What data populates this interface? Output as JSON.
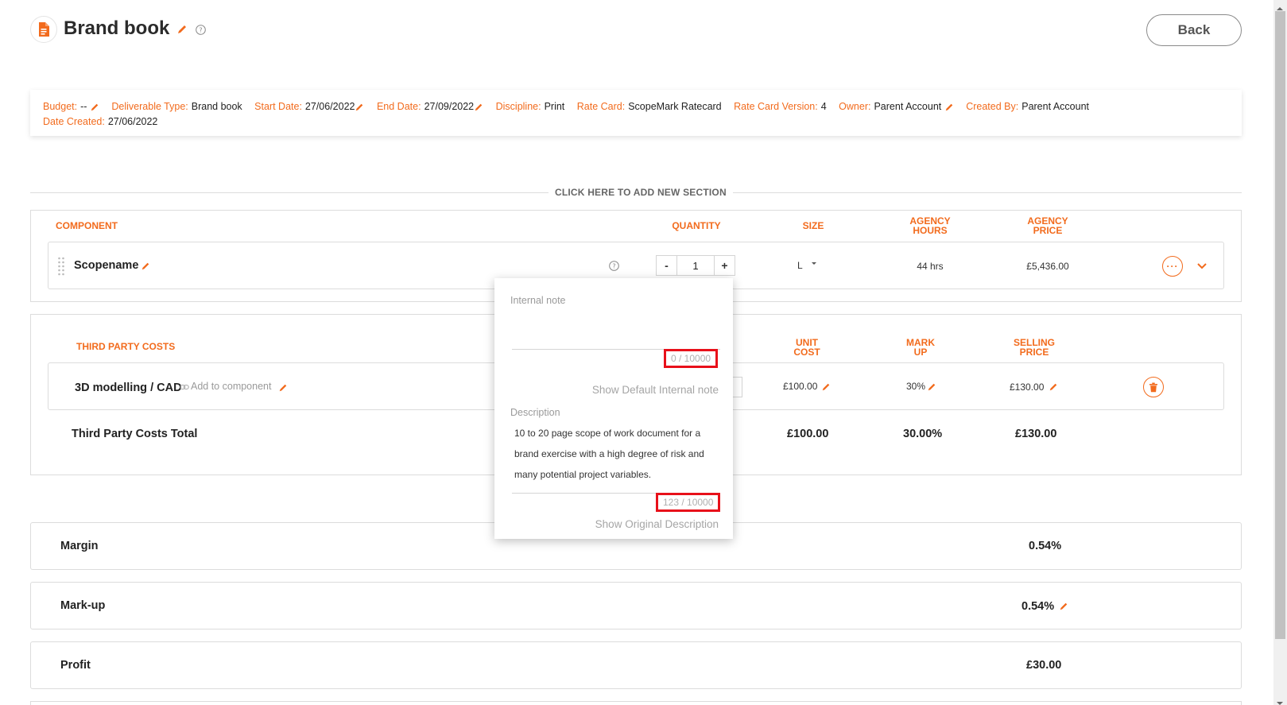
{
  "header": {
    "title": "Brand book",
    "back_label": "Back"
  },
  "info_bar": {
    "budget_label": "Budget:",
    "budget_value": "--",
    "deliverable_type_label": "Deliverable Type:",
    "deliverable_type_value": "Brand book",
    "start_date_label": "Start Date:",
    "start_date_value": "27/06/2022",
    "end_date_label": "End Date:",
    "end_date_value": "27/09/2022",
    "discipline_label": "Discipline:",
    "discipline_value": "Print",
    "rate_card_label": "Rate Card:",
    "rate_card_value": "ScopeMark Ratecard",
    "rate_card_version_label": "Rate Card Version:",
    "rate_card_version_value": "4",
    "owner_label": "Owner:",
    "owner_value": "Parent Account",
    "created_by_label": "Created By:",
    "created_by_value": "Parent Account",
    "date_created_label": "Date Created:",
    "date_created_value": "27/06/2022"
  },
  "add_section_label": "CLICK HERE TO ADD NEW SECTION",
  "component_section": {
    "headers": {
      "component": "COMPONENT",
      "quantity": "QUANTITY",
      "size": "SIZE",
      "agency_hours_1": "AGENCY",
      "agency_hours_2": "HOURS",
      "agency_price_1": "AGENCY",
      "agency_price_2": "PRICE"
    },
    "row": {
      "name": "Scopename",
      "quantity": "1",
      "qty_minus": "-",
      "qty_plus": "+",
      "size": "L",
      "hours": "44 hrs",
      "price": "£5,436.00",
      "more": "···"
    }
  },
  "third_party": {
    "title": "THIRD PARTY COSTS",
    "headers": {
      "unit_cost_1": "UNIT",
      "unit_cost_2": "COST",
      "mark_up_1": "MARK",
      "mark_up_2": "UP",
      "selling_price_1": "SELLING",
      "selling_price_2": "PRICE"
    },
    "row": {
      "name": "3D modelling / CAD",
      "add_to_component": "Add to component",
      "unit_cost": "£100.00",
      "mark_up": "30%",
      "selling_price": "£130.00"
    },
    "total": {
      "label": "Third Party Costs Total",
      "unit_cost": "£100.00",
      "mark_up": "30.00%",
      "selling_price": "£130.00"
    }
  },
  "summary": {
    "margin_label": "Margin",
    "margin_value": "0.54%",
    "markup_label": "Mark-up",
    "markup_value": "0.54%",
    "profit_label": "Profit",
    "profit_value": "£30.00"
  },
  "popup": {
    "internal_note_label": "Internal note",
    "internal_note_counter": "0 / 10000",
    "show_default_internal_note": "Show Default Internal note",
    "description_label": "Description",
    "description_line_1": "10 to 20 page scope of work document for a",
    "description_line_2": "brand exercise with a high degree of risk and",
    "description_line_3": "many potential project variables.",
    "description_counter": "123 / 10000",
    "show_original_description": "Show Original Description"
  },
  "colors": {
    "accent": "#f26b1d",
    "highlight": "#e8101a"
  }
}
